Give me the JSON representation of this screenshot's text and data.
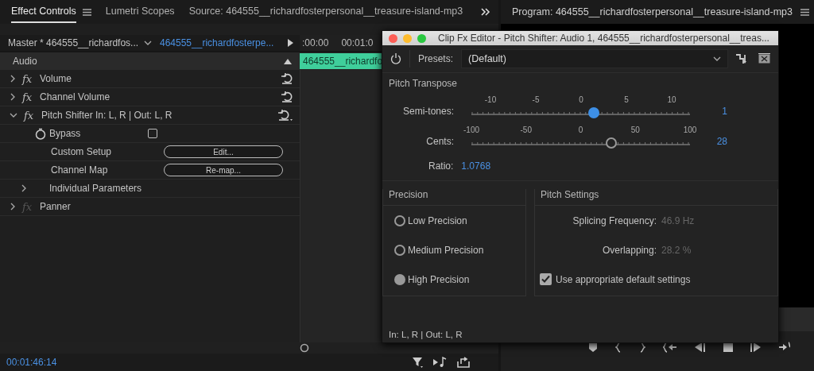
{
  "left_panel": {
    "tabs": [
      {
        "label": "Effect Controls",
        "selected": true
      },
      {
        "label": "Lumetri Scopes",
        "selected": false
      },
      {
        "label": "Source: 464555__richardfosterpersonal__treasure-island-mp3",
        "selected": false
      }
    ],
    "master_clip": "Master * 464555__richardfos...",
    "sequence_clip": "464555__richardfosterpe...",
    "ruler": [
      ":00:00",
      "00:01:0"
    ],
    "clip_label": "464555__richardfo",
    "section": "Audio",
    "effects": [
      {
        "badge": "fx",
        "name": "Volume",
        "expanded": false,
        "enabled": true
      },
      {
        "badge": "fx",
        "name": "Channel Volume",
        "expanded": false,
        "enabled": true
      },
      {
        "badge": "fx",
        "name": "Pitch Shifter In: L, R | Out: L, R",
        "expanded": true,
        "enabled": true,
        "children": [
          {
            "kind": "toggle",
            "label": "Bypass",
            "checked": false
          },
          {
            "kind": "button",
            "label": "Custom Setup",
            "button": "Edit..."
          },
          {
            "kind": "button",
            "label": "Channel Map",
            "button": "Re-map..."
          },
          {
            "kind": "group",
            "label": "Individual Parameters",
            "expanded": false
          }
        ]
      },
      {
        "badge": "fx",
        "name": "Panner",
        "expanded": false,
        "enabled": false
      }
    ],
    "timecode": "00:01:46:14"
  },
  "program_panel": {
    "title": "Program: 464555__richardfosterpersonal__treasure-island-mp3"
  },
  "dialog": {
    "title": "Clip Fx Editor - Pitch Shifter: Audio 1, 464555__richardfosterpersonal__treas...",
    "presets_label": "Presets:",
    "preset": "(Default)",
    "pitch_transpose": {
      "title": "Pitch Transpose",
      "sliders": [
        {
          "label": "Semi-tones:",
          "ticks": [
            "-10",
            "-5",
            "0",
            "5",
            "10"
          ],
          "level": 0.56,
          "value": "1",
          "active": true
        },
        {
          "label": "Cents:",
          "ticks": [
            "-100",
            "-50",
            "0",
            "50",
            "100"
          ],
          "level": 0.64,
          "value": "28",
          "active": false
        }
      ],
      "ratio_label": "Ratio:",
      "ratio": "1.0768"
    },
    "precision": {
      "title": "Precision",
      "options": [
        {
          "label": "Low Precision",
          "selected": false
        },
        {
          "label": "Medium Precision",
          "selected": false
        },
        {
          "label": "High Precision",
          "selected": true
        }
      ]
    },
    "pitch_settings": {
      "title": "Pitch Settings",
      "fields": [
        {
          "label": "Splicing Frequency:",
          "value": "46.9 Hz",
          "disabled": true
        },
        {
          "label": "Overlapping:",
          "value": "28.2 %",
          "disabled": true
        }
      ],
      "use_defaults": {
        "label": "Use appropriate default settings",
        "checked": true
      }
    },
    "footer": "In: L, R | Out: L, R"
  }
}
